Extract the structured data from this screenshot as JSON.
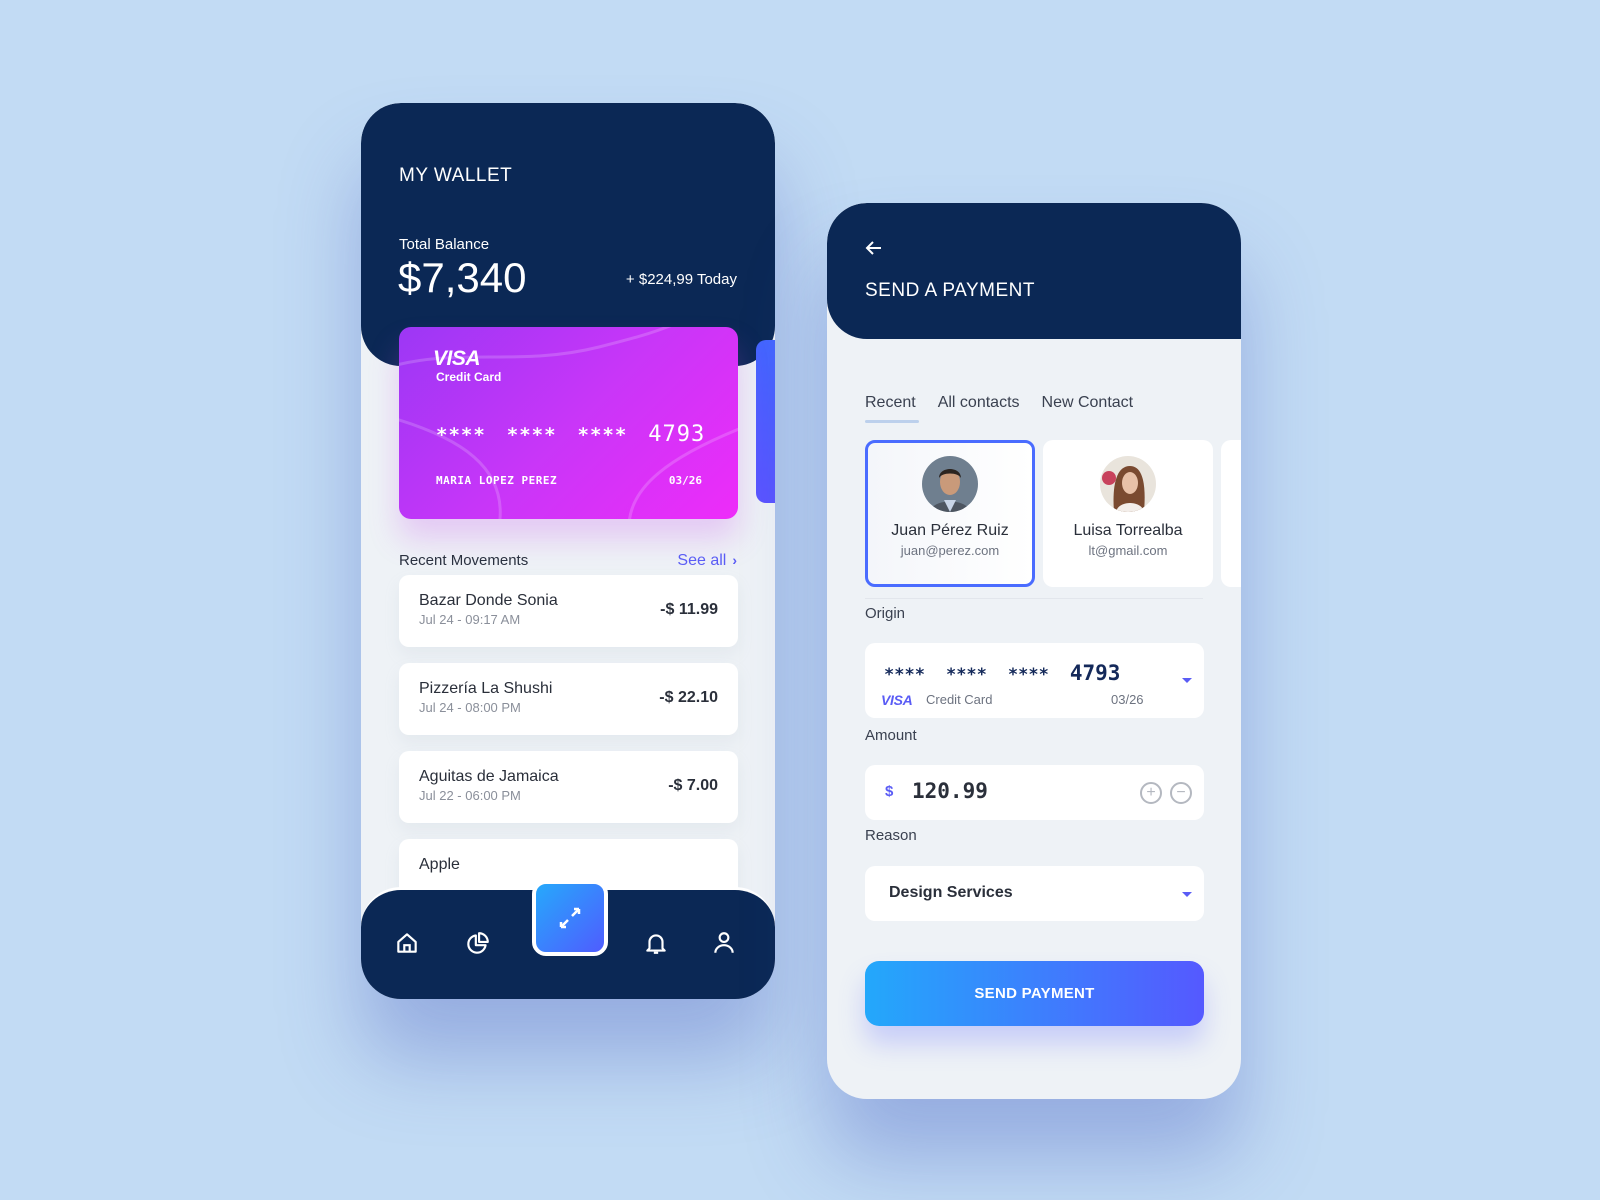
{
  "wallet": {
    "title": "MY WALLET",
    "balance_label": "Total Balance",
    "balance_value": "$7,340",
    "balance_change": "+ $224,99 Today",
    "card": {
      "brand": "VISA",
      "type": "Credit Card",
      "masked_groups": [
        "****",
        "****",
        "****"
      ],
      "last4": "4793",
      "holder": "MARIA LOPEZ PEREZ",
      "expiry": "03/26"
    },
    "movements_title": "Recent Movements",
    "see_all": "See all",
    "movements": [
      {
        "name": "Bazar Donde Sonia",
        "date": "Jul 24 - 09:17 AM",
        "amount": "-$ 11.99"
      },
      {
        "name": "Pizzería La Shushi",
        "date": "Jul 24 - 08:00 PM",
        "amount": "-$ 22.10"
      },
      {
        "name": "Aguitas de Jamaica",
        "date": "Jul 22 - 06:00 PM",
        "amount": "-$ 7.00"
      },
      {
        "name": "Apple",
        "date": "",
        "amount": ""
      }
    ],
    "nav": [
      "home-icon",
      "chart-pie-icon",
      "transfer-icon",
      "bell-icon",
      "user-icon"
    ]
  },
  "payment": {
    "title": "SEND A PAYMENT",
    "tabs": [
      "Recent",
      "All contacts",
      "New Contact"
    ],
    "active_tab": "Recent",
    "contacts": [
      {
        "name": "Juan Pérez Ruiz",
        "email": "juan@perez.com",
        "selected": true
      },
      {
        "name": "Luisa Torrealba",
        "email": "lt@gmail.com",
        "selected": false
      }
    ],
    "origin_label": "Origin",
    "origin": {
      "masked_groups": [
        "****",
        "****",
        "****"
      ],
      "last4": "4793",
      "brand": "VISA",
      "type": "Credit Card",
      "expiry": "03/26"
    },
    "amount_label": "Amount",
    "amount_currency": "$",
    "amount_value": "120.99",
    "amount_plus": "+",
    "amount_minus": "−",
    "reason_label": "Reason",
    "reason_value": "Design Services",
    "send_label": "SEND PAYMENT"
  },
  "colors": {
    "navy": "#0b2855",
    "accent": "#5a5cf5",
    "background": "#c2dbf4"
  }
}
